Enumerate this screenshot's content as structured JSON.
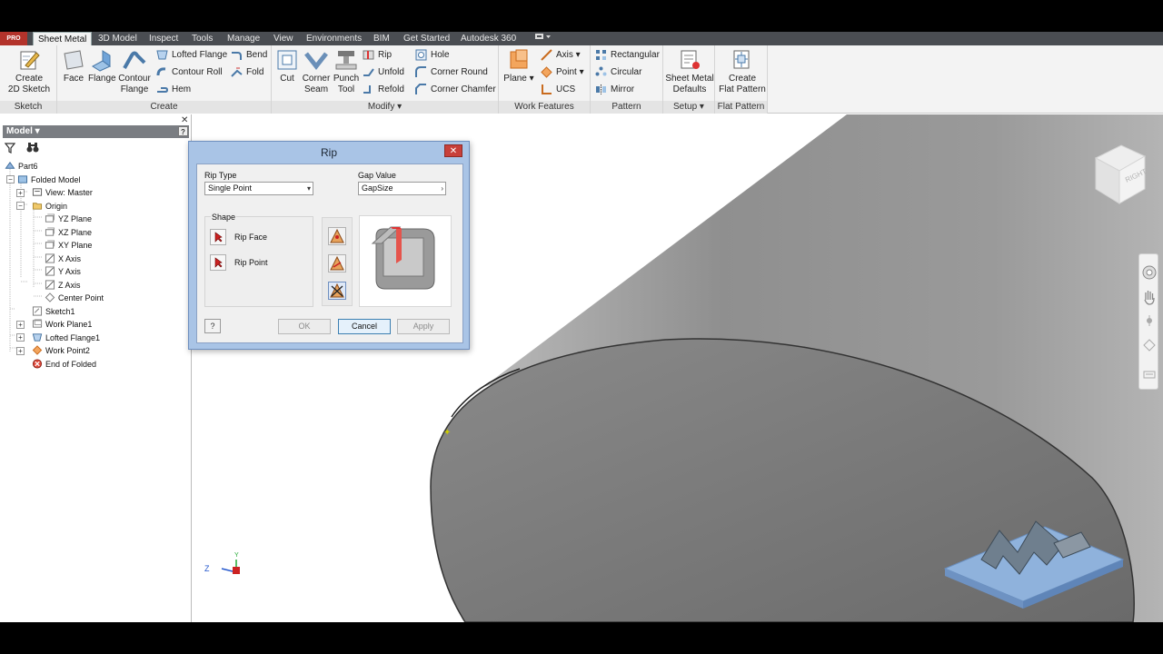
{
  "app": {
    "badge": "PRO"
  },
  "tabs": [
    "Sheet Metal",
    "3D Model",
    "Inspect",
    "Tools",
    "Manage",
    "View",
    "Environments",
    "BIM",
    "Get Started",
    "Autodesk 360"
  ],
  "ribbon": {
    "sketch": {
      "label": "Sketch",
      "create_2d_sketch": [
        "Create",
        "2D Sketch"
      ]
    },
    "create": {
      "label": "Create",
      "face": "Face",
      "flange": "Flange",
      "contour_flange": [
        "Contour",
        "Flange"
      ],
      "lofted_flange": "Lofted Flange",
      "contour_roll": "Contour Roll",
      "hem": "Hem",
      "bend": "Bend",
      "fold": "Fold"
    },
    "modify": {
      "label": "Modify",
      "cut": "Cut",
      "corner_seam": [
        "Corner",
        "Seam"
      ],
      "punch_tool": [
        "Punch",
        "Tool"
      ],
      "rip": "Rip",
      "unfold": "Unfold",
      "refold": "Refold",
      "hole": "Hole",
      "corner_round": "Corner Round",
      "corner_chamfer": "Corner Chamfer"
    },
    "work_features": {
      "label": "Work Features",
      "plane": "Plane",
      "axis": "Axis",
      "point": "Point",
      "ucs": "UCS"
    },
    "pattern": {
      "label": "Pattern",
      "rectangular": "Rectangular",
      "circular": "Circular",
      "mirror": "Mirror"
    },
    "setup": {
      "label": "Setup",
      "sheet_metal_defaults": [
        "Sheet Metal",
        "Defaults"
      ]
    },
    "flat_pattern": {
      "label": "Flat Pattern",
      "create_flat_pattern": [
        "Create",
        "Flat Pattern"
      ]
    }
  },
  "browser": {
    "title": "Model",
    "help": "?",
    "tree": [
      {
        "label": "Part6",
        "icon": "part-icon"
      },
      {
        "label": "Folded Model",
        "icon": "folded-model-icon"
      },
      {
        "label": "View: Master",
        "icon": "view-icon"
      },
      {
        "label": "Origin",
        "icon": "folder-icon"
      },
      {
        "label": "YZ Plane",
        "icon": "plane-icon"
      },
      {
        "label": "XZ Plane",
        "icon": "plane-icon"
      },
      {
        "label": "XY Plane",
        "icon": "plane-icon"
      },
      {
        "label": "X Axis",
        "icon": "axis-icon"
      },
      {
        "label": "Y Axis",
        "icon": "axis-icon"
      },
      {
        "label": "Z Axis",
        "icon": "axis-icon"
      },
      {
        "label": "Center Point",
        "icon": "point-icon"
      },
      {
        "label": "Sketch1",
        "icon": "sketch-icon"
      },
      {
        "label": "Work Plane1",
        "icon": "work-plane-icon"
      },
      {
        "label": "Lofted Flange1",
        "icon": "lofted-flange-icon"
      },
      {
        "label": "Work Point2",
        "icon": "work-point-icon"
      },
      {
        "label": "End of Folded",
        "icon": "end-of-folded-icon"
      }
    ]
  },
  "dialog": {
    "title": "Rip",
    "rip_type_label": "Rip Type",
    "rip_type_value": "Single Point",
    "gap_value_label": "Gap Value",
    "gap_value": "GapSize",
    "shape_label": "Shape",
    "rip_face": "Rip Face",
    "rip_point": "Rip Point",
    "ok": "OK",
    "cancel": "Cancel",
    "apply": "Apply",
    "help": "?"
  },
  "viewcube": {
    "face_label": "RIGHT"
  },
  "triad": {
    "z": "Z",
    "y": "Y"
  },
  "colors": {
    "accent": "#b3332b",
    "tabbar": "#4a4d52",
    "dialog_frame": "#a9c4e6",
    "model_gray": "#8a8a8a"
  }
}
